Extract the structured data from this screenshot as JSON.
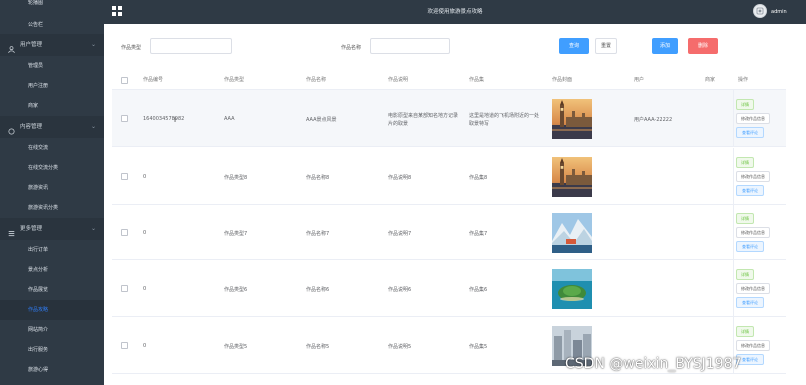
{
  "sidebar": {
    "top_items": [
      "轮播图",
      "公告栏"
    ],
    "groups": [
      {
        "label": "用户管理",
        "items": [
          "管理员",
          "用户注册",
          "商家"
        ]
      },
      {
        "label": "内容管理",
        "items": [
          "在线交流",
          "在线交流分类",
          "旅游资讯",
          "旅游资讯分类"
        ]
      },
      {
        "label": "更多管理",
        "items": [
          "出行订单",
          "景点分析",
          "作品展览",
          "作品攻略",
          "网站简介",
          "出行服务",
          "旅游心得"
        ]
      }
    ],
    "active_item": "作品攻略"
  },
  "header": {
    "title": "欢迎使用旅游景点攻略",
    "user": "admin"
  },
  "search": {
    "type_label": "作品类型",
    "name_label": "作品名称",
    "query_button": "查询",
    "reset_button": "重置",
    "add_button": "添加",
    "delete_button": "删除"
  },
  "table": {
    "columns": [
      "作品编号",
      "作品类型",
      "作品名称",
      "作品说明",
      "作品集",
      "作品封面",
      "用户",
      "商家",
      "操作"
    ],
    "rows": [
      {
        "id": "1640034578982",
        "type": "AAA",
        "name": "AAA景点风景",
        "desc": "电影原型来自某部知名地方记录片的取景",
        "collection": "这里是地道的飞机场附近的一处取景特写",
        "user": "用户AAA-22222",
        "merchant": "",
        "thumb": "london"
      },
      {
        "id": "0",
        "type": "作品类型8",
        "name": "作品名称8",
        "desc": "作品说明8",
        "collection": "作品集8",
        "user": "",
        "merchant": "",
        "thumb": "london"
      },
      {
        "id": "0",
        "type": "作品类型7",
        "name": "作品名称7",
        "desc": "作品说明7",
        "collection": "作品集7",
        "user": "",
        "merchant": "",
        "thumb": "mountain"
      },
      {
        "id": "0",
        "type": "作品类型6",
        "name": "作品名称6",
        "desc": "作品说明6",
        "collection": "作品集6",
        "user": "",
        "merchant": "",
        "thumb": "island"
      },
      {
        "id": "0",
        "type": "作品类型5",
        "name": "作品名称5",
        "desc": "作品说明5",
        "collection": "作品集5",
        "user": "",
        "merchant": "",
        "thumb": "city"
      }
    ],
    "op_labels": {
      "detail": "详情",
      "edit": "修改作品信息",
      "view": "查看评论"
    }
  },
  "watermark": "CSDN @weixin_BYSJ1987",
  "colors": {
    "sidebar_bg": "#2f3a45",
    "primary": "#409eff",
    "danger": "#f56c6c",
    "success": "#67c23a"
  }
}
